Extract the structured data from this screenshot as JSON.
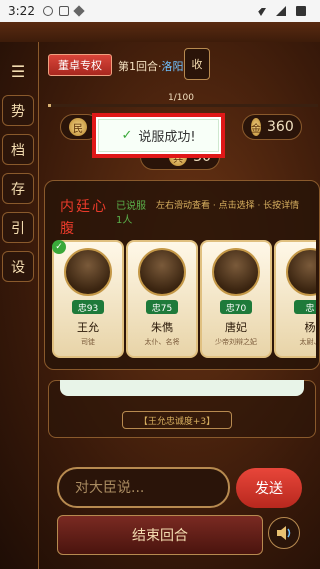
{
  "status_bar": {
    "time": "3:22"
  },
  "sidebar": {
    "menu_icon": "☰",
    "items": [
      {
        "label": "势"
      },
      {
        "label": "档"
      },
      {
        "label": "存"
      },
      {
        "label": "引"
      },
      {
        "label": "设"
      }
    ]
  },
  "header": {
    "role": "董卓专权",
    "round_text": "第1回合·",
    "place": "洛阳",
    "collect_label": "收"
  },
  "progress": {
    "label": "1/100",
    "fraction": 0.01
  },
  "resources": {
    "left_coin": "民",
    "right_coin": "金",
    "right_value": "360",
    "mid_coin": "兵",
    "mid_value": "30"
  },
  "toast": {
    "icon": "✓",
    "message": "说服成功!"
  },
  "harem": {
    "title": "内廷心腹",
    "persuaded": "已说服1人",
    "hint": "左右滑动查看 · 点击选择 · 长按详情"
  },
  "cards": [
    {
      "name": "王允",
      "loyalty": "忠93",
      "title": "司徒"
    },
    {
      "name": "朱儁",
      "loyalty": "忠75",
      "title": "太仆、名将"
    },
    {
      "name": "唐妃",
      "loyalty": "忠70",
      "title": "少帝刘辩之妃"
    },
    {
      "name": "杨",
      "loyalty": "忠",
      "title": "太尉、"
    }
  ],
  "effect_tag": "【王允忠诚度+3】",
  "chat": {
    "placeholder": "对大臣说...",
    "send_label": "发送"
  },
  "end_turn_label": "结束回合",
  "colors": {
    "accent_red": "#e01818",
    "gold": "#d8b060",
    "loyal_green": "#1e7a3a"
  }
}
